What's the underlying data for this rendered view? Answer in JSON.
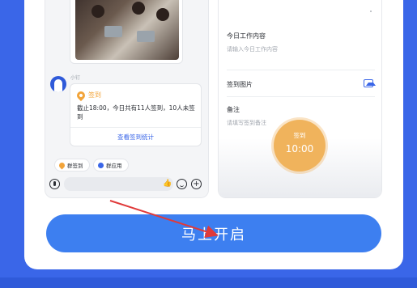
{
  "chat": {
    "sender": "小钉",
    "sign_card": {
      "title": "签到",
      "body": "截止18:00，今日共有11人签到，10人未签到",
      "link": "查看签到统计"
    },
    "chips": [
      {
        "label": "群签到",
        "icon": "pin-icon"
      },
      {
        "label": "群应用",
        "icon": "app-icon"
      }
    ]
  },
  "form": {
    "work_label": "今日工作内容",
    "work_placeholder": "请输入今日工作内容",
    "photo_label": "签到图片",
    "note_label": "备注",
    "note_placeholder": "请填写签到备注"
  },
  "checkin": {
    "label": "签到",
    "time": "10:00"
  },
  "cta": {
    "label": "马上开启"
  },
  "colors": {
    "background": "#3a66e8",
    "accent_orange": "#f0b35c",
    "button": "#3d7ff0",
    "arrow": "#e03a3a"
  }
}
